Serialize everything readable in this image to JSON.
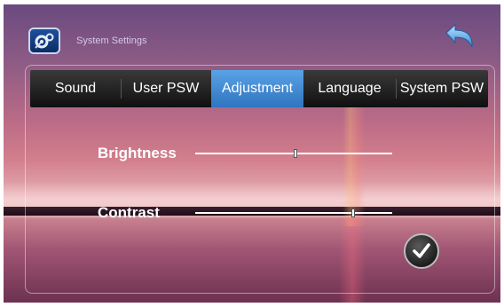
{
  "header": {
    "title": "System Settings",
    "settings_icon": "settings-gear-icon",
    "back_icon": "back-arrow-icon"
  },
  "tabs": [
    {
      "label": "Sound",
      "active": false
    },
    {
      "label": "User PSW",
      "active": false
    },
    {
      "label": "Adjustment",
      "active": true
    },
    {
      "label": "Language",
      "active": false
    },
    {
      "label": "System PSW",
      "active": false
    }
  ],
  "sliders": {
    "brightness": {
      "label": "Brightness",
      "value": 0.51
    },
    "contrast": {
      "label": "Contrast",
      "value": 0.8
    }
  },
  "confirm": {
    "icon": "checkmark-icon"
  },
  "colors": {
    "active_tab": "#3d86d4",
    "tabbar": "#1c1c1c",
    "text": "#ffffff"
  }
}
